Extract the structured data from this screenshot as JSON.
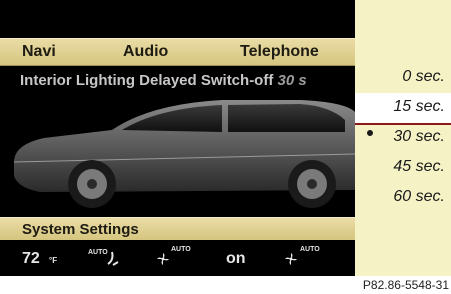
{
  "nav": {
    "items": [
      "Navi",
      "Audio",
      "Telephone"
    ]
  },
  "setting": {
    "title": "Interior Lighting Delayed Switch-off",
    "value_suffix": "30 s"
  },
  "options": {
    "items": [
      "0 sec.",
      "15 sec.",
      "30 sec.",
      "45 sec.",
      "60 sec."
    ],
    "highlighted": "15 sec.",
    "selected": "30 sec."
  },
  "system": {
    "label": "System Settings"
  },
  "climate": {
    "temp": "72",
    "temp_unit": "°F",
    "auto_left": "AUTO",
    "auto_mid": "AUTO",
    "on": "on",
    "auto_right": "AUTO"
  },
  "caption": "P82.86-5548-31"
}
